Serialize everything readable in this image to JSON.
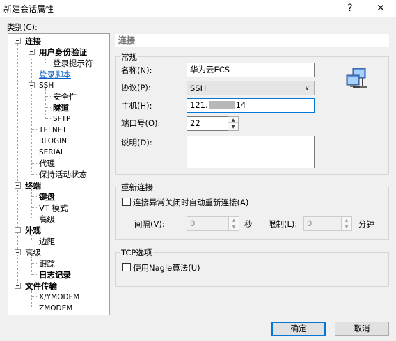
{
  "window": {
    "title": "新建会话属性",
    "help_button": "?",
    "close_button": "✕"
  },
  "category_label": "类别(C):",
  "tree": {
    "connection": "连接",
    "user_auth": "用户身份验证",
    "login_prompts": "登录提示符",
    "login_script": "登录脚本",
    "ssh": "SSH",
    "security": "安全性",
    "tunnel": "隧道",
    "sftp": "SFTP",
    "telnet": "TELNET",
    "rlogin": "RLOGIN",
    "serial": "SERIAL",
    "proxy": "代理",
    "keepalive": "保持活动状态",
    "terminal": "终端",
    "keyboard": "键盘",
    "vt_mode": "VT 模式",
    "advanced1": "高级",
    "appearance": "外观",
    "margin": "边距",
    "advanced2": "高级",
    "trace": "跟踪",
    "logging": "日志记录",
    "file_transfer": "文件传输",
    "xymodem": "X/YMODEM",
    "zmodem": "ZMODEM"
  },
  "section_title": "连接",
  "general": {
    "title": "常规",
    "name_label": "名称(N):",
    "name_value": "华为云ECS",
    "protocol_label": "协议(P):",
    "protocol_value": "SSH",
    "host_label": "主机(H):",
    "host_prefix": "121.",
    "host_suffix": "14",
    "port_label": "端口号(O):",
    "port_value": "22",
    "desc_label": "说明(D):",
    "desc_value": ""
  },
  "reconnect": {
    "title": "重新连接",
    "auto_label": "连接异常关闭时自动重新连接(A)",
    "interval_label": "间隔(V):",
    "interval_value": "0",
    "seconds_unit": "秒",
    "limit_label": "限制(L):",
    "limit_value": "0",
    "minutes_unit": "分钟"
  },
  "tcp": {
    "title": "TCP选项",
    "nagle_label": "使用Nagle算法(U)"
  },
  "buttons": {
    "ok": "确定",
    "cancel": "取消"
  }
}
